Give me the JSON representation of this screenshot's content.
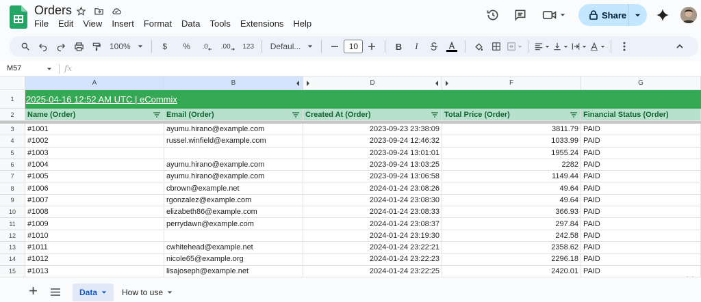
{
  "doc": {
    "title": "Orders"
  },
  "menu": [
    "File",
    "Edit",
    "View",
    "Insert",
    "Format",
    "Data",
    "Tools",
    "Extensions",
    "Help"
  ],
  "share": {
    "label": "Share"
  },
  "toolbar": {
    "zoom": "100%",
    "currency": "$",
    "percent": "%",
    "dec_dec": ".0",
    "dec_inc": ".00",
    "number_format": "123",
    "font": "Defaul...",
    "font_size": "10",
    "bold": "B",
    "italic": "I"
  },
  "formula_bar": {
    "name_box": "M57",
    "fx": "fx"
  },
  "columns": [
    {
      "letter": "A",
      "selected": true
    },
    {
      "letter": "B",
      "selected": true
    },
    {
      "letter": "D",
      "selected": false
    },
    {
      "letter": "F",
      "selected": false
    },
    {
      "letter": "G",
      "selected": false
    }
  ],
  "banner": {
    "text": "2025-04-16 12:52 AM UTC | eCommix"
  },
  "headers": [
    "Name (Order)",
    "Email (Order)",
    "Created At (Order)",
    "Total Price (Order)",
    "Financial Status (Order)"
  ],
  "row_numbers": [
    "1",
    "2",
    "3",
    "4",
    "5",
    "6",
    "7",
    "8",
    "9",
    "10",
    "11",
    "12",
    "13",
    "14",
    "15"
  ],
  "rows": [
    {
      "name": "#1001",
      "email": "ayumu.hirano@example.com",
      "created": "2023-09-23 23:38:09",
      "total": "3811.79",
      "status": "PAID"
    },
    {
      "name": "#1002",
      "email": "russel.winfield@example.com",
      "created": "2023-09-24 12:46:32",
      "total": "1033.99",
      "status": "PAID"
    },
    {
      "name": "#1003",
      "email": "",
      "created": "2023-09-24 13:01:01",
      "total": "1955.24",
      "status": "PAID"
    },
    {
      "name": "#1004",
      "email": "ayumu.hirano@example.com",
      "created": "2023-09-24 13:03:25",
      "total": "2282",
      "status": "PAID"
    },
    {
      "name": "#1005",
      "email": "ayumu.hirano@example.com",
      "created": "2023-09-24 13:06:58",
      "total": "1149.44",
      "status": "PAID"
    },
    {
      "name": "#1006",
      "email": "cbrown@example.net",
      "created": "2024-01-24 23:08:26",
      "total": "49.64",
      "status": "PAID"
    },
    {
      "name": "#1007",
      "email": "rgonzalez@example.com",
      "created": "2024-01-24 23:08:30",
      "total": "49.64",
      "status": "PAID"
    },
    {
      "name": "#1008",
      "email": "elizabeth86@example.com",
      "created": "2024-01-24 23:08:33",
      "total": "366.93",
      "status": "PAID"
    },
    {
      "name": "#1009",
      "email": "perrydawn@example.com",
      "created": "2024-01-24 23:08:37",
      "total": "297.84",
      "status": "PAID"
    },
    {
      "name": "#1010",
      "email": "",
      "created": "2024-01-24 23:19:30",
      "total": "242.58",
      "status": "PAID"
    },
    {
      "name": "#1011",
      "email": "cwhitehead@example.net",
      "created": "2024-01-24 23:22:21",
      "total": "2358.62",
      "status": "PAID"
    },
    {
      "name": "#1012",
      "email": "nicole65@example.org",
      "created": "2024-01-24 23:22:23",
      "total": "2296.18",
      "status": "PAID"
    },
    {
      "name": "#1013",
      "email": "lisajoseph@example.net",
      "created": "2024-01-24 23:22:25",
      "total": "2420.01",
      "status": "PAID"
    }
  ],
  "sheets": [
    {
      "label": "Data",
      "active": true
    },
    {
      "label": "How to use",
      "active": false
    }
  ],
  "colors": {
    "banner": "#34a853",
    "header_fill": "#b7e1cd",
    "header_text": "#0d652d",
    "share_bg": "#c2e7ff"
  }
}
